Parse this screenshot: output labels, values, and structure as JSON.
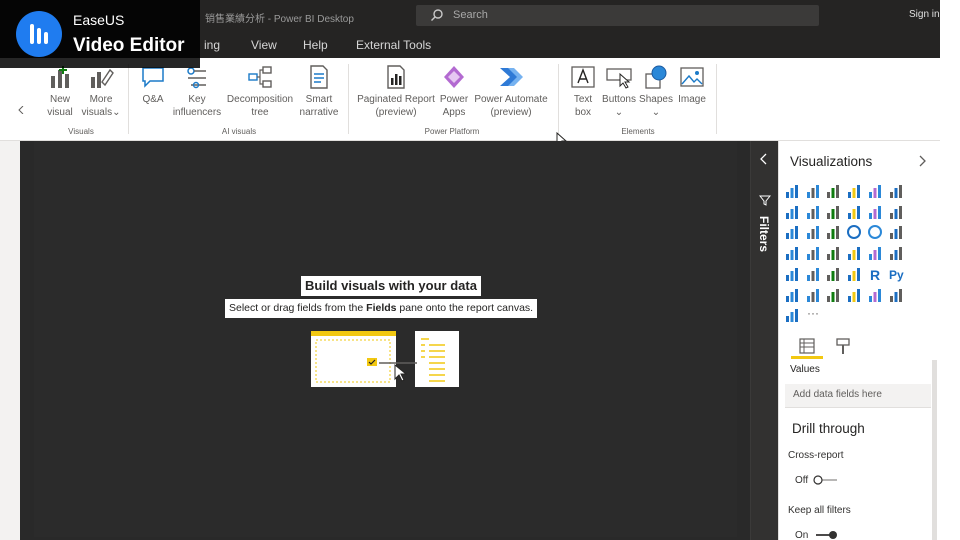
{
  "overlay": {
    "brand_top": "EaseUS",
    "brand_bottom": "Video Editor"
  },
  "titlebar": {
    "document": "销售業績分析 - Power BI Desktop",
    "search_placeholder": "Search",
    "sign_in": "Sign in"
  },
  "menu_tabs": [
    "ing",
    "View",
    "Help",
    "External Tools"
  ],
  "ribbon": {
    "buttons": [
      {
        "id": "new-visual",
        "l1": "New",
        "l2": "visual"
      },
      {
        "id": "more-visuals",
        "l1": "More",
        "l2": "visuals⌄"
      },
      {
        "id": "qa",
        "l1": "Q&A",
        "l2": ""
      },
      {
        "id": "key-influencers",
        "l1": "Key",
        "l2": "influencers"
      },
      {
        "id": "decomposition-tree",
        "l1": "Decomposition",
        "l2": "tree"
      },
      {
        "id": "smart-narrative",
        "l1": "Smart",
        "l2": "narrative"
      },
      {
        "id": "paginated-report",
        "l1": "Paginated Report",
        "l2": "(preview)"
      },
      {
        "id": "power-apps",
        "l1": "Power",
        "l2": "Apps"
      },
      {
        "id": "power-automate",
        "l1": "Power Automate",
        "l2": "(preview)"
      },
      {
        "id": "text-box",
        "l1": "Text",
        "l2": "box"
      },
      {
        "id": "buttons",
        "l1": "Buttons",
        "l2": "⌄"
      },
      {
        "id": "shapes",
        "l1": "Shapes",
        "l2": "⌄"
      },
      {
        "id": "image",
        "l1": "Image",
        "l2": ""
      }
    ],
    "groups": {
      "visuals": "Visuals",
      "ai": "AI visuals",
      "power": "Power Platform",
      "elements": "Elements"
    }
  },
  "canvas": {
    "title": "Build visuals with your data",
    "sub_pre": "Select or drag fields from the ",
    "sub_bold": "Fields",
    "sub_post": " pane onto the report canvas."
  },
  "filters": {
    "label": "Filters"
  },
  "visualizations": {
    "title": "Visualizations",
    "icons": [
      "stacked-bar",
      "stacked-column",
      "clustered-bar",
      "clustered-column",
      "100-bar",
      "100-column",
      "line",
      "area",
      "stacked-area",
      "line-column",
      "line-clustered",
      "ribbon",
      "waterfall",
      "funnel",
      "scatter",
      "pie",
      "donut",
      "treemap",
      "map",
      "filled-map",
      "azure-map",
      "gauge",
      "card",
      "multi-row-card",
      "kpi",
      "slicer",
      "table",
      "matrix",
      "r-visual",
      "python-visual",
      "key-influencers",
      "decomposition",
      "qa",
      "narrative",
      "paginated",
      "power-apps",
      "power-automate",
      "more"
    ],
    "values_label": "Values",
    "drop_placeholder": "Add data fields here",
    "drill_through": "Drill through",
    "cross_report": "Cross-report",
    "cross_report_state": "Off",
    "keep_all_filters": "Keep all filters",
    "keep_all_state": "On"
  },
  "colors": {
    "accent": "#f2c811",
    "dark": "#252423",
    "canvas": "#2b2b2b",
    "brand": "#1f7cf0"
  }
}
